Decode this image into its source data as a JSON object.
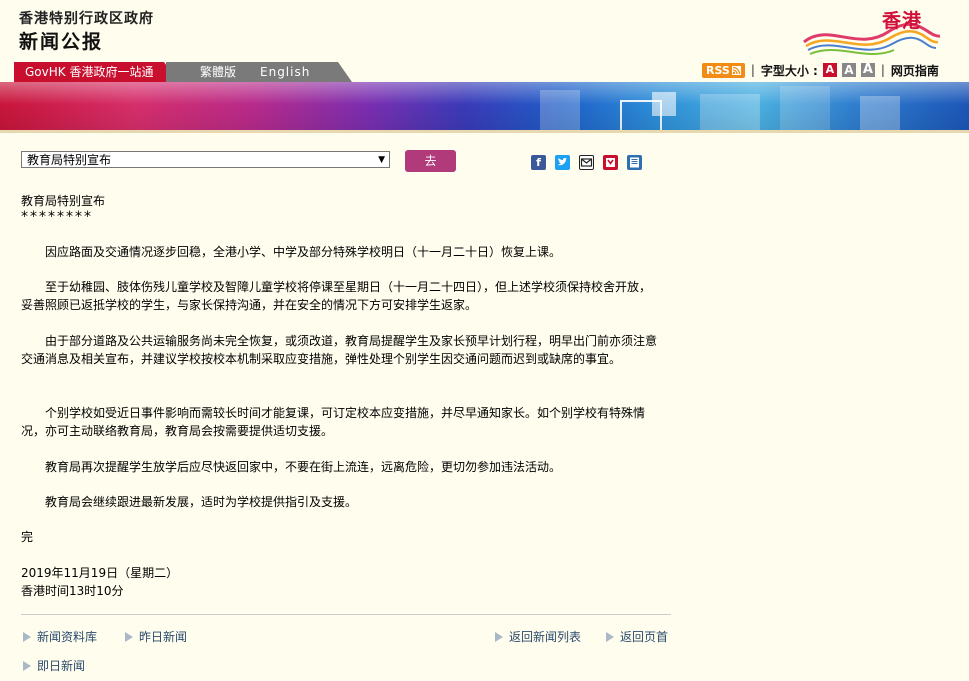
{
  "header": {
    "gov_name": "香港特别行政区政府",
    "section_title": "新闻公报",
    "brand_text": "香港"
  },
  "nav": {
    "gov_tab": "GovHK 香港政府一站通",
    "lang_tc": "繁體版",
    "lang_en": "English"
  },
  "utility": {
    "rss": "RSS",
    "font_size_label": "字型大小 :",
    "font_sizes": [
      "A",
      "A",
      "A"
    ],
    "sitemap": "网页指南",
    "separator": "|"
  },
  "toolbar": {
    "select_value": "教育局特别宣布",
    "go_label": "去",
    "share_icons": [
      "facebook-icon",
      "twitter-icon",
      "email-icon",
      "bookmark-icon",
      "print-icon"
    ]
  },
  "article": {
    "title": "教育局特别宣布",
    "stars": "********",
    "paragraphs": [
      "因应路面及交通情况逐步回稳，全港小学、中学及部分特殊学校明日（十一月二十日）恢复上课。",
      "至于幼稚园、肢体伤残儿童学校及智障儿童学校将停课至星期日（十一月二十四日），但上述学校须保持校舍开放，妥善照顾已返抵学校的学生，与家长保持沟通，并在安全的情况下方可安排学生返家。",
      "由于部分道路及公共运输服务尚未完全恢复，或须改道，教育局提醒学生及家长预早计划行程，明早出门前亦须注意交通消息及相关宣布，并建议学校按校本机制采取应变措施，弹性处理个别学生因交通问题而迟到或缺席的事宜。",
      "个别学校如受近日事件影响而需较长时间才能复课，可订定校本应变措施，并尽早通知家长。如个别学校有特殊情况，亦可主动联络教育局，教育局会按需要提供适切支援。",
      "教育局再次提醒学生放学后应尽快返回家中，不要在街上流连，远离危险，更切勿参加违法活动。",
      "教育局会继续跟进最新发展，适时为学校提供指引及支援。"
    ],
    "end": "完",
    "date": "2019年11月19日（星期二）",
    "time": "香港时间13时10分"
  },
  "footer": {
    "news_archive": "新闻资料库",
    "yesterday": "昨日新闻",
    "back_list": "返回新闻列表",
    "back_top": "返回页首",
    "today": "即日新闻"
  },
  "colors": {
    "page_bg": "#fffdee",
    "gov_red": "#c8102e",
    "link": "#2b4b6b",
    "go_button": "#b03a7a"
  }
}
